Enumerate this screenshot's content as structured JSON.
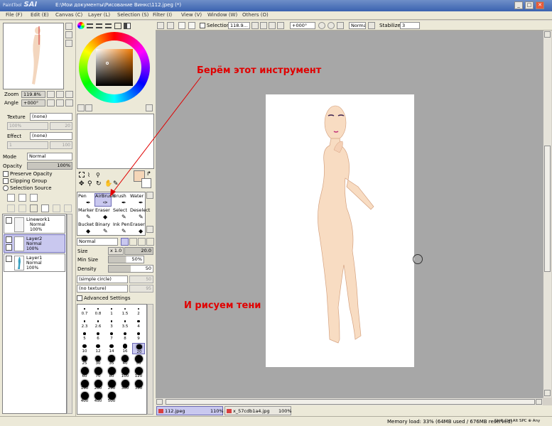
{
  "title_bar": {
    "logo_small": "PaintTool",
    "logo": "SAI",
    "window_title": "E:\\Мои документы\\Рисование Винкс\\112.jpeg (*)",
    "min": "_",
    "max": "□",
    "close": "✕"
  },
  "menu": [
    "File (F)",
    "Edit (E)",
    "Canvas (C)",
    "Layer (L)",
    "Selection (S)",
    "Filter (I)",
    "View (V)",
    "Window (W)",
    "Others (O)"
  ],
  "navigator": {
    "zoom_label": "Zoom",
    "zoom_value": "119.8%",
    "angle_label": "Angle",
    "angle_value": "+000°"
  },
  "layer_props": {
    "texture_label": "Texture",
    "texture_value": "(none)",
    "scale_label": "Scale",
    "scale_value": "100%",
    "scale_num": "20",
    "effect_label": "Effect",
    "effect_value": "(none)",
    "width_label": "Width",
    "width_value": "1",
    "width_num": "100",
    "mode_label": "Mode",
    "mode_value": "Normal",
    "opacity_label": "Opacity",
    "opacity_value": "100%",
    "preserve_opacity": "Preserve Opacity",
    "clipping_group": "Clipping Group",
    "selection_source": "Selection Source"
  },
  "layers": [
    {
      "name": "Linework1",
      "mode": "Normal",
      "opacity": "100%"
    },
    {
      "name": "Layer2",
      "mode": "Normal",
      "opacity": "100%"
    },
    {
      "name": "Layer1",
      "mode": "Normal",
      "opacity": "100%"
    }
  ],
  "tools": [
    {
      "label": "Pen"
    },
    {
      "label": "AirBrush"
    },
    {
      "label": "Brush"
    },
    {
      "label": "Water"
    },
    {
      "label": "Marker"
    },
    {
      "label": "Eraser"
    },
    {
      "label": "Select"
    },
    {
      "label": "Deselect"
    },
    {
      "label": "Bucket"
    },
    {
      "label": "Binary"
    },
    {
      "label": "Ink Pen"
    },
    {
      "label": "Eraser"
    }
  ],
  "brush_settings": {
    "mode": "Normal",
    "size_label": "Size",
    "size_mult": "x 1.0",
    "size_value": "20.0",
    "minsize_label": "Min Size",
    "minsize_value": "50%",
    "density_label": "Density",
    "density_value": "50",
    "shape": "(simple circle)",
    "shape_num": "50",
    "texture": "(no texture)",
    "texture_num": "95",
    "advanced": "Advanced Settings"
  },
  "brush_sizes": [
    "0.7",
    "0.8",
    "1",
    "1.5",
    "2",
    "2.3",
    "2.6",
    "3",
    "3.5",
    "4",
    "5",
    "6",
    "7",
    "8",
    "9",
    "10",
    "12",
    "14",
    "16",
    "20",
    "25",
    "30",
    "35",
    "40",
    "50",
    "60",
    "70",
    "80",
    "100",
    "120",
    "160",
    "200",
    "250",
    "300",
    "350",
    "400",
    "450",
    "500"
  ],
  "toolbar": {
    "selection_label": "Selection",
    "zoom_value": "118.9...",
    "angle_value": "+000°",
    "mode_value": "Normal",
    "stabilizer_label": "Stabilizer",
    "stabilizer_value": "3"
  },
  "annotations": {
    "tool_note": "Берём этот инструмент",
    "shade_note": "И рисуем тени"
  },
  "tabs": [
    {
      "name": "112.jpeg",
      "zoom": "110%"
    },
    {
      "name": "x_57cdb1a4.jpg",
      "zoom": "100%"
    }
  ],
  "status": {
    "memory": "Memory load: 33% (64MB used / 676MB reserved)",
    "keys": "Shift Ctrl Alt SPC ⊕ Any"
  },
  "colors": {
    "accent": "#3a62b0",
    "selected_layer": "#c9c8ef",
    "annotation": "#e00000",
    "primary_color": "#f5d6b8"
  }
}
